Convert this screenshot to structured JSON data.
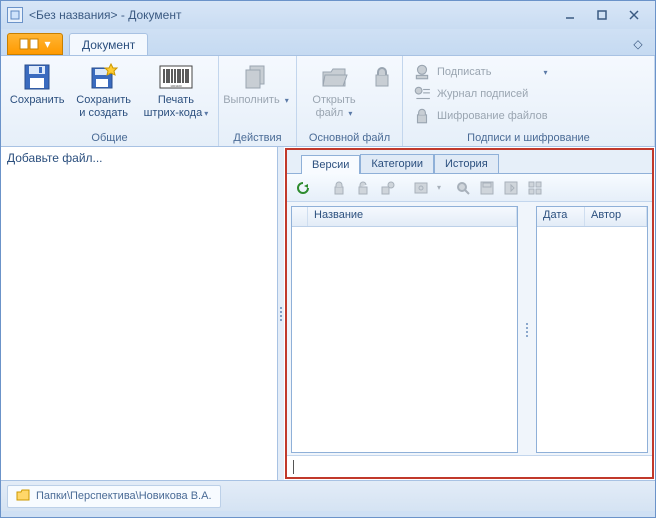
{
  "window": {
    "title": "<Без названия> - Документ"
  },
  "ribbon": {
    "tab_document": "Документ",
    "groups": {
      "common": {
        "label": "Общие",
        "save": "Сохранить",
        "save_create_l1": "Сохранить",
        "save_create_l2": "и создать",
        "barcode_l1": "Печать",
        "barcode_l2": "штрих-кода"
      },
      "actions": {
        "label": "Действия",
        "execute": "Выполнить"
      },
      "mainfile": {
        "label": "Основной файл",
        "open_l1": "Открыть",
        "open_l2": "файл"
      },
      "sign": {
        "label": "Подписи и шифрование",
        "sign": "Подписать",
        "journal": "Журнал подписей",
        "encrypt": "Шифрование файлов"
      }
    }
  },
  "leftpane": {
    "placeholder": "Добавьте файл..."
  },
  "rightpane": {
    "tabs": {
      "versions": "Версии",
      "categories": "Категории",
      "history": "История"
    },
    "columns": {
      "name": "Название",
      "date": "Дата",
      "author": "Автор"
    }
  },
  "status": {
    "path": "Папки\\Перспектива\\Новикова В.А."
  }
}
